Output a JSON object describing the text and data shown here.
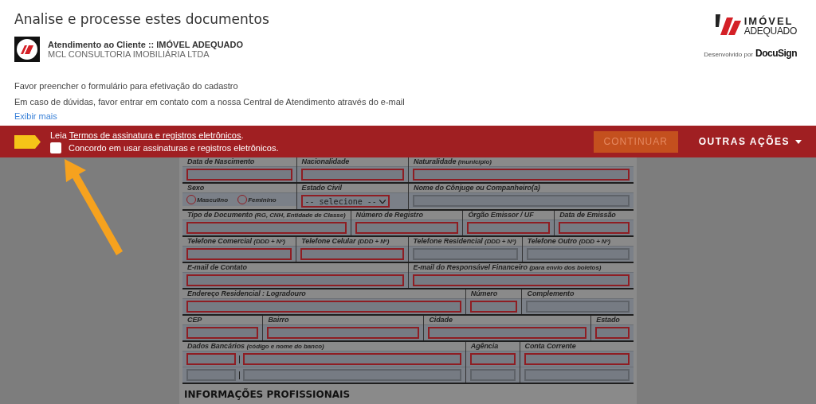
{
  "header": {
    "title": "Analise e processe estes documentos",
    "sender": {
      "name": "Atendimento ao Cliente :: IMÓVEL ADEQUADO",
      "company": "MCL CONSULTORIA IMOBILIÁRIA LTDA"
    },
    "brand_logo": {
      "line1": "IMÓVEL",
      "line2": "ADEQUADO"
    },
    "powered_by": {
      "label": "Desenvolvido por",
      "brand": "DocuSign"
    }
  },
  "message": {
    "lines": [
      "Favor preencher o formulário para efetivação do cadastro",
      "Em caso de dúvidas, favor entrar em contato com a nossa Central de Atendimento através do e-mail"
    ],
    "more_link": "Exibir mais"
  },
  "consent_bar": {
    "prefix": "Leia ",
    "link": "Termos de assinatura e registros eletrônicos",
    "suffix": ".",
    "checkbox": {
      "label": "Concordo em usar assinaturas e registros eletrônicos.",
      "checked": false
    },
    "continue_button": {
      "label": "CONTINUAR",
      "disabled": true
    },
    "more_actions": {
      "label": "OUTRAS AÇÕES"
    }
  },
  "document": {
    "rows": [
      {
        "cells": [
          {
            "label": "Data de Nascimento",
            "lines": [
              [
                {
                  "kind": "text",
                  "required": true
                }
              ]
            ]
          },
          {
            "label": "Nacionalidade",
            "lines": [
              [
                {
                  "kind": "text",
                  "required": true
                }
              ]
            ]
          },
          {
            "label": "Naturalidade",
            "note": "(município)",
            "lines": [
              [
                {
                  "kind": "text",
                  "required": true
                }
              ]
            ]
          }
        ]
      },
      {
        "cells": [
          {
            "label": "Sexo",
            "lines": [
              [
                {
                  "kind": "radio",
                  "label": "Masculino",
                  "selected": false
                },
                {
                  "kind": "radio",
                  "label": "Feminino",
                  "selected": false
                }
              ]
            ]
          },
          {
            "label": "Estado Civil",
            "lines": [
              [
                {
                  "kind": "select",
                  "value": "-- selecione --",
                  "required": true
                }
              ]
            ]
          },
          {
            "label": "Nome do Cônjuge ou Companheiro(a)",
            "lines": [
              [
                {
                  "kind": "text",
                  "required": false
                }
              ]
            ]
          }
        ]
      },
      {
        "cells": [
          {
            "label": "Tipo de Documento",
            "note": "(RG, CNH, Entidade de Classe)",
            "lines": [
              [
                {
                  "kind": "text",
                  "required": true
                }
              ]
            ]
          },
          {
            "label": "Número de Registro",
            "lines": [
              [
                {
                  "kind": "text",
                  "required": true
                }
              ]
            ]
          },
          {
            "label": "Órgão Emissor / UF",
            "lines": [
              [
                {
                  "kind": "text",
                  "required": true
                }
              ]
            ]
          },
          {
            "label": "Data de Emissão",
            "lines": [
              [
                {
                  "kind": "text",
                  "required": true
                }
              ]
            ]
          }
        ]
      },
      {
        "cells": [
          {
            "label": "Telefone Comercial",
            "note": "(DDD + Nº)",
            "lines": [
              [
                {
                  "kind": "text",
                  "required": true
                }
              ]
            ]
          },
          {
            "label": "Telefone Celular",
            "note": "(DDD + Nº)",
            "lines": [
              [
                {
                  "kind": "text",
                  "required": true
                }
              ]
            ]
          },
          {
            "label": "Telefone Residencial",
            "note": "(DDD + Nº)",
            "lines": [
              [
                {
                  "kind": "text",
                  "required": false
                }
              ]
            ]
          },
          {
            "label": "Telefone Outro",
            "note": "(DDD + Nº)",
            "lines": [
              [
                {
                  "kind": "text",
                  "required": false
                }
              ]
            ]
          }
        ]
      },
      {
        "cells": [
          {
            "label": "E-mail de Contato",
            "lines": [
              [
                {
                  "kind": "text",
                  "required": true
                }
              ]
            ]
          },
          {
            "label": "E-mail do Responsável Financeiro",
            "note": "(para envio dos boletos)",
            "lines": [
              [
                {
                  "kind": "text",
                  "required": true
                }
              ]
            ]
          }
        ]
      },
      {
        "cells": [
          {
            "label": "Endereço Residencial : Logradouro",
            "lines": [
              [
                {
                  "kind": "text",
                  "required": true
                }
              ]
            ]
          },
          {
            "label": "Número",
            "lines": [
              [
                {
                  "kind": "text",
                  "required": true
                }
              ]
            ]
          },
          {
            "label": "Complemento",
            "lines": [
              [
                {
                  "kind": "text",
                  "required": false
                }
              ]
            ]
          }
        ]
      },
      {
        "cells": [
          {
            "label": "CEP",
            "lines": [
              [
                {
                  "kind": "text",
                  "required": true
                }
              ]
            ]
          },
          {
            "label": "Bairro",
            "lines": [
              [
                {
                  "kind": "text",
                  "required": true
                }
              ]
            ]
          },
          {
            "label": "Cidade",
            "lines": [
              [
                {
                  "kind": "text",
                  "required": true
                }
              ]
            ]
          },
          {
            "label": "Estado",
            "lines": [
              [
                {
                  "kind": "text",
                  "required": true
                }
              ]
            ]
          }
        ]
      },
      {
        "cells": [
          {
            "label": "Dados Bancários",
            "note": "(código e nome do banco)",
            "lines": [
              [
                {
                  "kind": "code",
                  "required": true
                },
                {
                  "kind": "text",
                  "required": true
                }
              ],
              [
                {
                  "kind": "code",
                  "required": false
                },
                {
                  "kind": "text",
                  "required": false
                }
              ]
            ]
          },
          {
            "label": "Agência",
            "lines": [
              [
                {
                  "kind": "text",
                  "required": true
                }
              ],
              [
                {
                  "kind": "text",
                  "required": false
                }
              ]
            ]
          },
          {
            "label": "Conta Corrente",
            "lines": [
              [
                {
                  "kind": "text",
                  "required": true
                }
              ],
              [
                {
                  "kind": "text",
                  "required": false
                }
              ]
            ]
          }
        ]
      }
    ],
    "section_heading": "INFORMAÇÕES PROFISSIONAIS"
  }
}
